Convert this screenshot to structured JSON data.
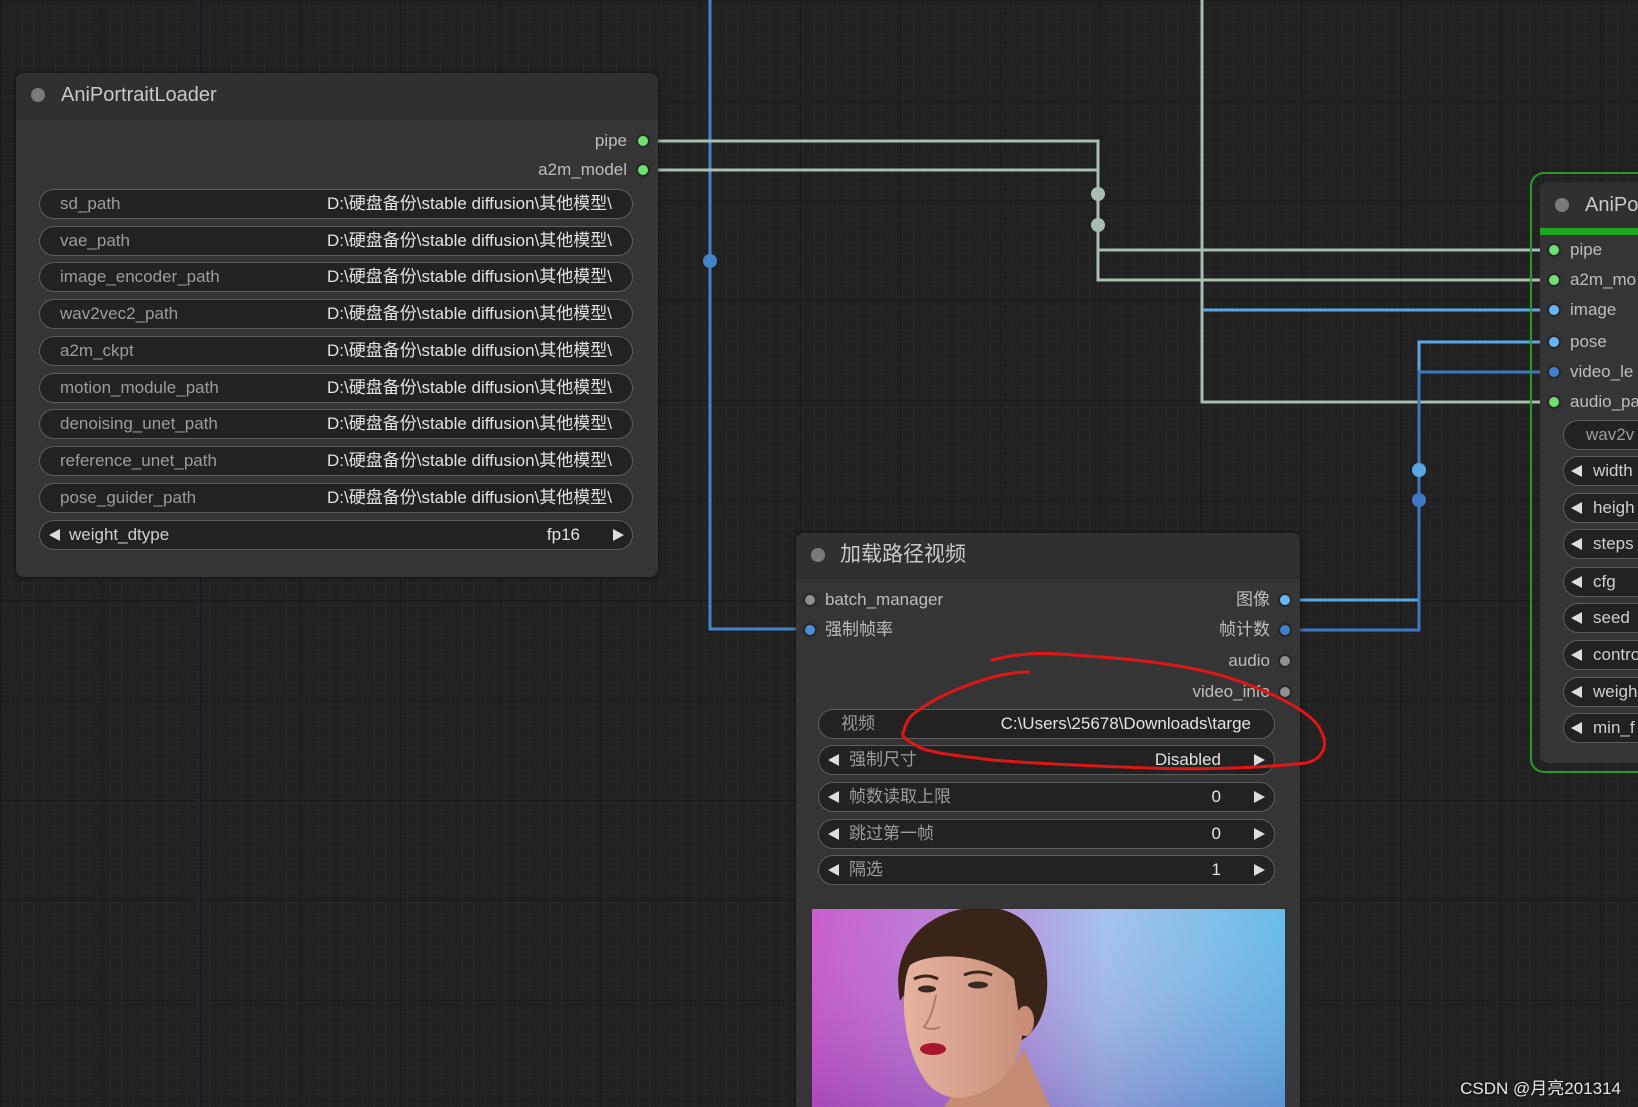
{
  "canvas": {
    "watermark": "CSDN @月亮201314"
  },
  "wires": {
    "pipe_color": "#a9bfae",
    "image_color": "#5aa7e6",
    "int_color": "#3f78c2",
    "float_color": "#4583c9",
    "faint_color": "#1c2737"
  },
  "annotation": {
    "color": "#e01515"
  },
  "loader": {
    "title": "AniPortraitLoader",
    "outputs": [
      {
        "label": "pipe",
        "color": "#6fe06f"
      },
      {
        "label": "a2m_model",
        "color": "#6fe06f"
      }
    ],
    "widgets": [
      {
        "label": "sd_path",
        "value": "D:\\硬盘备份\\stable diffusion\\其他模型\\"
      },
      {
        "label": "vae_path",
        "value": "D:\\硬盘备份\\stable diffusion\\其他模型\\"
      },
      {
        "label": "image_encoder_path",
        "value": "D:\\硬盘备份\\stable diffusion\\其他模型\\"
      },
      {
        "label": "wav2vec2_path",
        "value": "D:\\硬盘备份\\stable diffusion\\其他模型\\"
      },
      {
        "label": "a2m_ckpt",
        "value": "D:\\硬盘备份\\stable diffusion\\其他模型\\"
      },
      {
        "label": "motion_module_path",
        "value": "D:\\硬盘备份\\stable diffusion\\其他模型\\"
      },
      {
        "label": "denoising_unet_path",
        "value": "D:\\硬盘备份\\stable diffusion\\其他模型\\"
      },
      {
        "label": "reference_unet_path",
        "value": "D:\\硬盘备份\\stable diffusion\\其他模型\\"
      },
      {
        "label": "pose_guider_path",
        "value": "D:\\硬盘备份\\stable diffusion\\其他模型\\"
      }
    ],
    "weight_dtype": {
      "label": "weight_dtype",
      "value": "fp16"
    }
  },
  "video_loader": {
    "title": "加载路径视频",
    "inputs": [
      {
        "label": "batch_manager",
        "color": "#8f8f8f"
      },
      {
        "label": "强制帧率",
        "color": "#4a8fd8"
      }
    ],
    "outputs": [
      {
        "label": "图像",
        "color": "#64b5f6"
      },
      {
        "label": "帧计数",
        "color": "#3f80cc"
      },
      {
        "label": "audio",
        "color": "#8f8f8f"
      },
      {
        "label": "video_info",
        "color": "#8f8f8f"
      }
    ],
    "video_path": {
      "label": "视频",
      "value": "C:\\Users\\25678\\Downloads\\targe"
    },
    "options": [
      {
        "label": "强制尺寸",
        "value": "Disabled"
      },
      {
        "label": "帧数读取上限",
        "value": "0"
      },
      {
        "label": "跳过第一帧",
        "value": "0"
      },
      {
        "label": "隔选",
        "value": "1"
      }
    ]
  },
  "animate_node": {
    "title": "AniPo",
    "inputs": [
      {
        "label": "pipe",
        "color": "#6fe06f"
      },
      {
        "label": "a2m_mo",
        "color": "#6fe06f"
      },
      {
        "label": "image",
        "color": "#64b5f6"
      },
      {
        "label": "pose",
        "color": "#64b5f6"
      },
      {
        "label": "video_le",
        "color": "#3f80cc"
      },
      {
        "label": "audio_pa",
        "color": "#6fe06f"
      }
    ],
    "text_widget": {
      "label": "wav2v"
    },
    "widgets": [
      {
        "label": "width"
      },
      {
        "label": "heigh"
      },
      {
        "label": "steps"
      },
      {
        "label": "cfg"
      },
      {
        "label": "seed"
      },
      {
        "label": "contro"
      },
      {
        "label": "weigh"
      },
      {
        "label": "min_f"
      }
    ]
  }
}
